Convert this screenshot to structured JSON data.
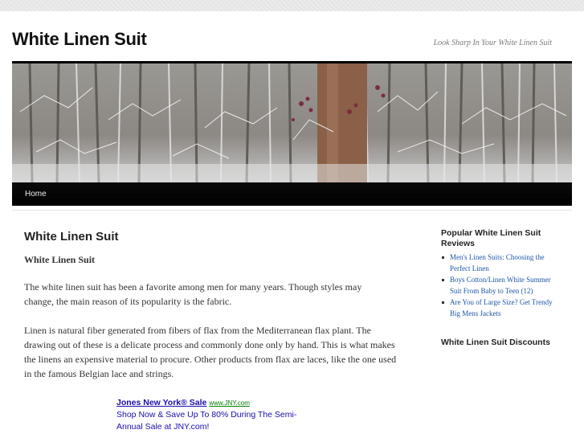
{
  "site": {
    "title": "White Linen Suit",
    "description": "Look Sharp In Your White Linen Suit"
  },
  "nav": {
    "home": "Home"
  },
  "post": {
    "title": "White Linen Suit",
    "subtitle": "White Linen Suit",
    "paragraphs": [
      "The white linen suit has been a favorite among men for many years. Though styles may change, the main reason of its popularity is the fabric.",
      "Linen is natural fiber generated from fibers of flax from the Mediterranean flax plant. The drawing out of these is a delicate process and commonly done only by hand. This is what makes the linens an expensive material to procure. Other products from flax are laces, like the one used in the famous Belgian lace and strings."
    ]
  },
  "ad": {
    "title": "Jones New York® Sale",
    "url": "www.JNY.com",
    "text": "Shop Now & Save Up To 80% During The Semi-Annual Sale at JNY.com!"
  },
  "sidebar": {
    "popular_title": "Popular White Linen Suit Reviews",
    "popular_items": [
      "Men's Linen Suits: Choosing the Perfect Linen",
      "Boys Cotton/Linen White Summer Suit From Baby to Teen (12)",
      "Are You of Large Size? Get Trendy Big Mens Jackets"
    ],
    "discounts_title": "White Linen Suit Discounts"
  },
  "colors": {
    "link": "#1b56a8",
    "ad_link": "#1a0dab",
    "ad_url": "#008000",
    "menu_bar": "#000000"
  }
}
